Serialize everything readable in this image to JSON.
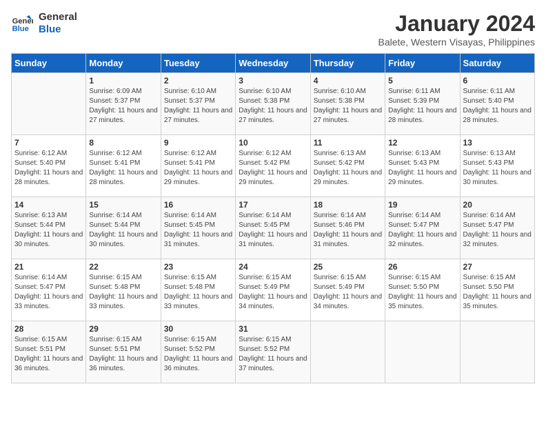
{
  "logo": {
    "line1": "General",
    "line2": "Blue"
  },
  "title": "January 2024",
  "location": "Balete, Western Visayas, Philippines",
  "headers": [
    "Sunday",
    "Monday",
    "Tuesday",
    "Wednesday",
    "Thursday",
    "Friday",
    "Saturday"
  ],
  "weeks": [
    [
      {
        "day": "",
        "sunrise": "",
        "sunset": "",
        "daylight": ""
      },
      {
        "day": "1",
        "sunrise": "Sunrise: 6:09 AM",
        "sunset": "Sunset: 5:37 PM",
        "daylight": "Daylight: 11 hours and 27 minutes."
      },
      {
        "day": "2",
        "sunrise": "Sunrise: 6:10 AM",
        "sunset": "Sunset: 5:37 PM",
        "daylight": "Daylight: 11 hours and 27 minutes."
      },
      {
        "day": "3",
        "sunrise": "Sunrise: 6:10 AM",
        "sunset": "Sunset: 5:38 PM",
        "daylight": "Daylight: 11 hours and 27 minutes."
      },
      {
        "day": "4",
        "sunrise": "Sunrise: 6:10 AM",
        "sunset": "Sunset: 5:38 PM",
        "daylight": "Daylight: 11 hours and 27 minutes."
      },
      {
        "day": "5",
        "sunrise": "Sunrise: 6:11 AM",
        "sunset": "Sunset: 5:39 PM",
        "daylight": "Daylight: 11 hours and 28 minutes."
      },
      {
        "day": "6",
        "sunrise": "Sunrise: 6:11 AM",
        "sunset": "Sunset: 5:40 PM",
        "daylight": "Daylight: 11 hours and 28 minutes."
      }
    ],
    [
      {
        "day": "7",
        "sunrise": "Sunrise: 6:12 AM",
        "sunset": "Sunset: 5:40 PM",
        "daylight": "Daylight: 11 hours and 28 minutes."
      },
      {
        "day": "8",
        "sunrise": "Sunrise: 6:12 AM",
        "sunset": "Sunset: 5:41 PM",
        "daylight": "Daylight: 11 hours and 28 minutes."
      },
      {
        "day": "9",
        "sunrise": "Sunrise: 6:12 AM",
        "sunset": "Sunset: 5:41 PM",
        "daylight": "Daylight: 11 hours and 29 minutes."
      },
      {
        "day": "10",
        "sunrise": "Sunrise: 6:12 AM",
        "sunset": "Sunset: 5:42 PM",
        "daylight": "Daylight: 11 hours and 29 minutes."
      },
      {
        "day": "11",
        "sunrise": "Sunrise: 6:13 AM",
        "sunset": "Sunset: 5:42 PM",
        "daylight": "Daylight: 11 hours and 29 minutes."
      },
      {
        "day": "12",
        "sunrise": "Sunrise: 6:13 AM",
        "sunset": "Sunset: 5:43 PM",
        "daylight": "Daylight: 11 hours and 29 minutes."
      },
      {
        "day": "13",
        "sunrise": "Sunrise: 6:13 AM",
        "sunset": "Sunset: 5:43 PM",
        "daylight": "Daylight: 11 hours and 30 minutes."
      }
    ],
    [
      {
        "day": "14",
        "sunrise": "Sunrise: 6:13 AM",
        "sunset": "Sunset: 5:44 PM",
        "daylight": "Daylight: 11 hours and 30 minutes."
      },
      {
        "day": "15",
        "sunrise": "Sunrise: 6:14 AM",
        "sunset": "Sunset: 5:44 PM",
        "daylight": "Daylight: 11 hours and 30 minutes."
      },
      {
        "day": "16",
        "sunrise": "Sunrise: 6:14 AM",
        "sunset": "Sunset: 5:45 PM",
        "daylight": "Daylight: 11 hours and 31 minutes."
      },
      {
        "day": "17",
        "sunrise": "Sunrise: 6:14 AM",
        "sunset": "Sunset: 5:45 PM",
        "daylight": "Daylight: 11 hours and 31 minutes."
      },
      {
        "day": "18",
        "sunrise": "Sunrise: 6:14 AM",
        "sunset": "Sunset: 5:46 PM",
        "daylight": "Daylight: 11 hours and 31 minutes."
      },
      {
        "day": "19",
        "sunrise": "Sunrise: 6:14 AM",
        "sunset": "Sunset: 5:47 PM",
        "daylight": "Daylight: 11 hours and 32 minutes."
      },
      {
        "day": "20",
        "sunrise": "Sunrise: 6:14 AM",
        "sunset": "Sunset: 5:47 PM",
        "daylight": "Daylight: 11 hours and 32 minutes."
      }
    ],
    [
      {
        "day": "21",
        "sunrise": "Sunrise: 6:14 AM",
        "sunset": "Sunset: 5:47 PM",
        "daylight": "Daylight: 11 hours and 33 minutes."
      },
      {
        "day": "22",
        "sunrise": "Sunrise: 6:15 AM",
        "sunset": "Sunset: 5:48 PM",
        "daylight": "Daylight: 11 hours and 33 minutes."
      },
      {
        "day": "23",
        "sunrise": "Sunrise: 6:15 AM",
        "sunset": "Sunset: 5:48 PM",
        "daylight": "Daylight: 11 hours and 33 minutes."
      },
      {
        "day": "24",
        "sunrise": "Sunrise: 6:15 AM",
        "sunset": "Sunset: 5:49 PM",
        "daylight": "Daylight: 11 hours and 34 minutes."
      },
      {
        "day": "25",
        "sunrise": "Sunrise: 6:15 AM",
        "sunset": "Sunset: 5:49 PM",
        "daylight": "Daylight: 11 hours and 34 minutes."
      },
      {
        "day": "26",
        "sunrise": "Sunrise: 6:15 AM",
        "sunset": "Sunset: 5:50 PM",
        "daylight": "Daylight: 11 hours and 35 minutes."
      },
      {
        "day": "27",
        "sunrise": "Sunrise: 6:15 AM",
        "sunset": "Sunset: 5:50 PM",
        "daylight": "Daylight: 11 hours and 35 minutes."
      }
    ],
    [
      {
        "day": "28",
        "sunrise": "Sunrise: 6:15 AM",
        "sunset": "Sunset: 5:51 PM",
        "daylight": "Daylight: 11 hours and 36 minutes."
      },
      {
        "day": "29",
        "sunrise": "Sunrise: 6:15 AM",
        "sunset": "Sunset: 5:51 PM",
        "daylight": "Daylight: 11 hours and 36 minutes."
      },
      {
        "day": "30",
        "sunrise": "Sunrise: 6:15 AM",
        "sunset": "Sunset: 5:52 PM",
        "daylight": "Daylight: 11 hours and 36 minutes."
      },
      {
        "day": "31",
        "sunrise": "Sunrise: 6:15 AM",
        "sunset": "Sunset: 5:52 PM",
        "daylight": "Daylight: 11 hours and 37 minutes."
      },
      {
        "day": "",
        "sunrise": "",
        "sunset": "",
        "daylight": ""
      },
      {
        "day": "",
        "sunrise": "",
        "sunset": "",
        "daylight": ""
      },
      {
        "day": "",
        "sunrise": "",
        "sunset": "",
        "daylight": ""
      }
    ]
  ]
}
